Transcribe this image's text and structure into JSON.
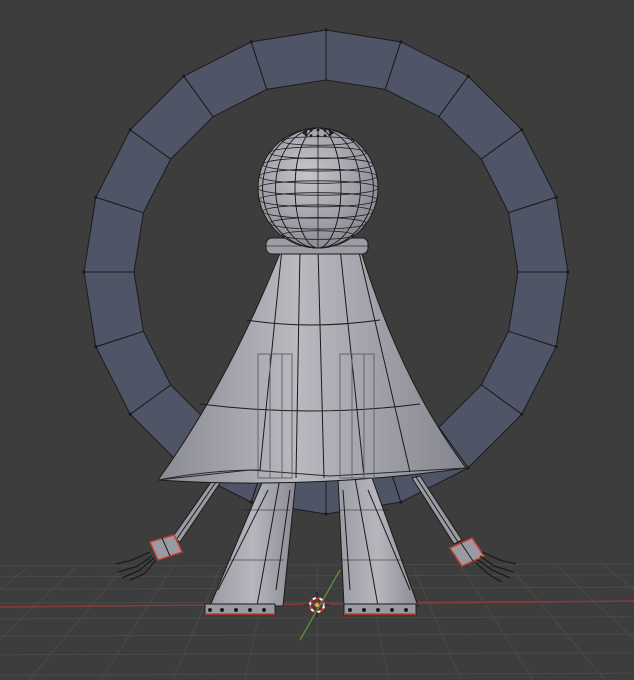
{
  "viewport": {
    "background": "#3d3d3d",
    "grid_color": "#4a4a4a",
    "x_axis_color": "#8a3a3a",
    "y_axis_color": "#5e8f3a"
  },
  "mesh": {
    "ring_fill": "#4f5467",
    "body_fill": "#a3a3ab",
    "body_shade": "#7c7c86",
    "wire_color": "#1b1b1b",
    "selected_color": "#d03a2a"
  },
  "cursor": {
    "icon": "3d-cursor-icon",
    "ring_colors": [
      "#ffffff",
      "#d03a2a"
    ]
  }
}
